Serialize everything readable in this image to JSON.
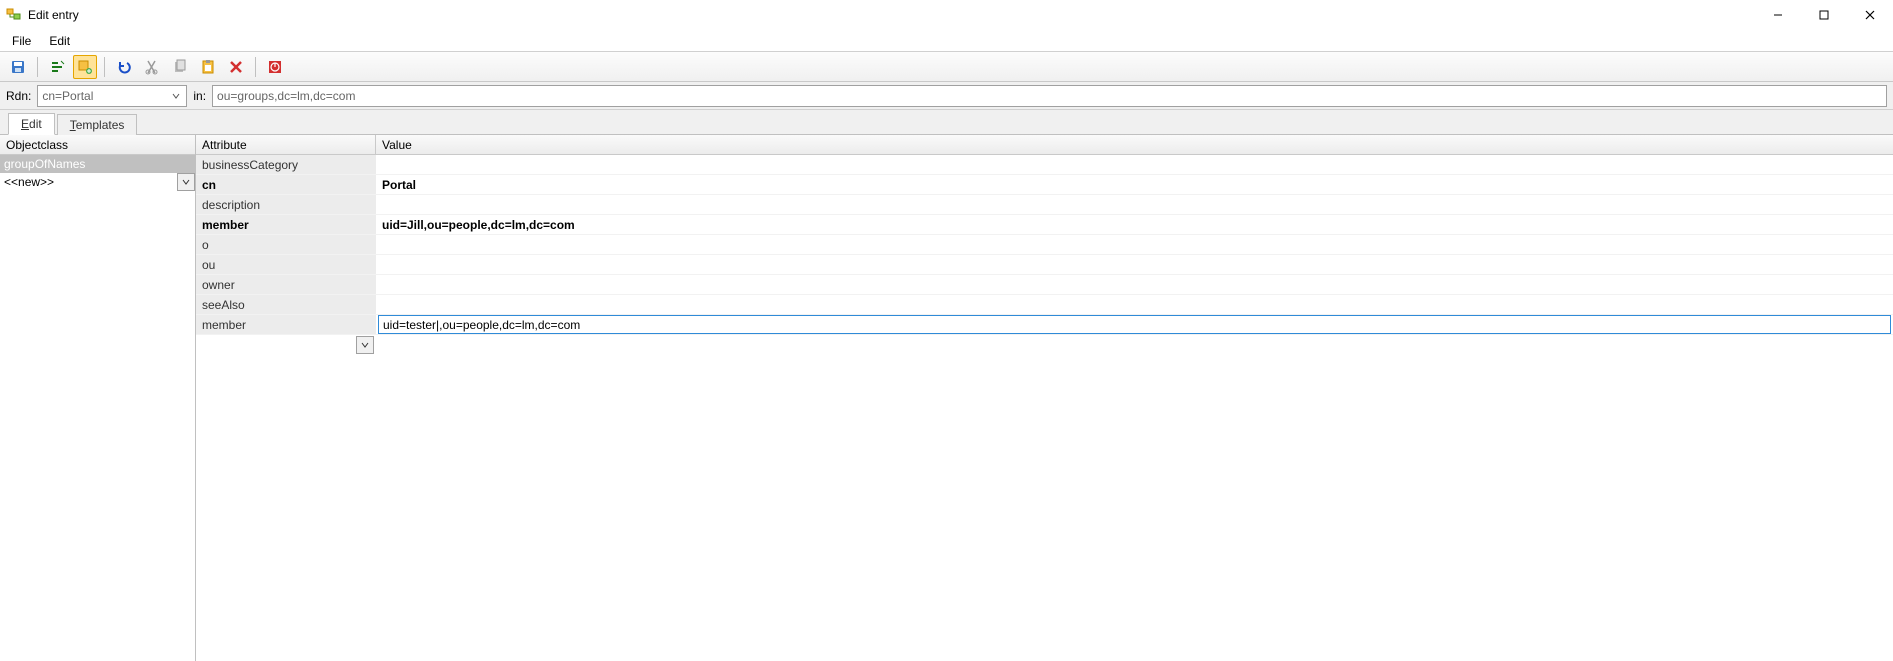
{
  "window": {
    "title": "Edit entry"
  },
  "menu": {
    "file": "File",
    "edit": "Edit"
  },
  "rdn": {
    "label": "Rdn:",
    "value": "cn=Portal",
    "in_label": "in:",
    "in_value": "ou=groups,dc=lm,dc=com"
  },
  "tabs": {
    "edit": "dit",
    "edit_pre": "E",
    "templates": "emplates",
    "templates_pre": "T"
  },
  "objectclass": {
    "header": "Objectclass",
    "items": [
      "groupOfNames"
    ],
    "new_label": "<<new>>"
  },
  "attributes": {
    "header_attr": "Attribute",
    "header_val": "Value",
    "rows": [
      {
        "name": "businessCategory",
        "value": "",
        "bold": false
      },
      {
        "name": "cn",
        "value": "Portal",
        "bold": true
      },
      {
        "name": "description",
        "value": "",
        "bold": false
      },
      {
        "name": "member",
        "value": "uid=Jill,ou=people,dc=lm,dc=com",
        "bold": true
      },
      {
        "name": "o",
        "value": "",
        "bold": false
      },
      {
        "name": "ou",
        "value": "",
        "bold": false
      },
      {
        "name": "owner",
        "value": "",
        "bold": false
      },
      {
        "name": "seeAlso",
        "value": "",
        "bold": false
      }
    ],
    "editing": {
      "name": "member",
      "value": "uid=tester|,ou=people,dc=lm,dc=com"
    }
  }
}
